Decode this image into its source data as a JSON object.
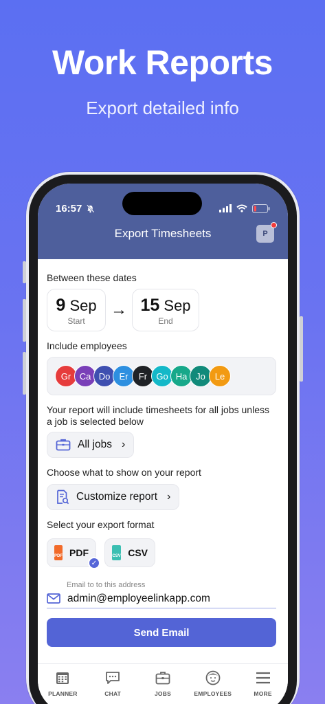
{
  "hero": {
    "title": "Work Reports",
    "subtitle": "Export detailed info"
  },
  "status": {
    "time": "16:57"
  },
  "nav": {
    "title": "Export Timesheets",
    "avatar": "P"
  },
  "dates": {
    "label": "Between these dates",
    "start": {
      "day": "9",
      "month": "Sep",
      "caption": "Start"
    },
    "end": {
      "day": "15",
      "month": "Sep",
      "caption": "End"
    }
  },
  "employees": {
    "label": "Include employees",
    "items": [
      {
        "initials": "Gr",
        "color": "#e63c3c"
      },
      {
        "initials": "Ca",
        "color": "#7a3fb8"
      },
      {
        "initials": "Do",
        "color": "#3e4fb0"
      },
      {
        "initials": "Er",
        "color": "#2d8fe0"
      },
      {
        "initials": "Fr",
        "color": "#1f2226"
      },
      {
        "initials": "Go",
        "color": "#14b8c8"
      },
      {
        "initials": "Ha",
        "color": "#17a88a"
      },
      {
        "initials": "Jo",
        "color": "#118a7a"
      },
      {
        "initials": "Le",
        "color": "#f29a12"
      }
    ]
  },
  "jobs": {
    "label": "Your report will include timesheets for all jobs unless a job is selected below",
    "button": "All jobs"
  },
  "customize": {
    "label": "Choose what to show on your report",
    "button": "Customize report"
  },
  "format": {
    "label": "Select your export format",
    "pdf": "PDF",
    "pdf_icon_text": "PDF",
    "csv": "CSV",
    "csv_icon_text": "CSV"
  },
  "email": {
    "label": "Email to to this address",
    "value": "admin@employeelinkapp.com",
    "send": "Send Email"
  },
  "tabs": [
    {
      "label": "PLANNER",
      "icon": "calendar-icon"
    },
    {
      "label": "CHAT",
      "icon": "chat-icon"
    },
    {
      "label": "JOBS",
      "icon": "briefcase-icon"
    },
    {
      "label": "EMPLOYEES",
      "icon": "employee-icon"
    },
    {
      "label": "MORE",
      "icon": "menu-icon"
    }
  ],
  "colors": {
    "accent": "#5364d6",
    "header": "#4e5f9c"
  }
}
